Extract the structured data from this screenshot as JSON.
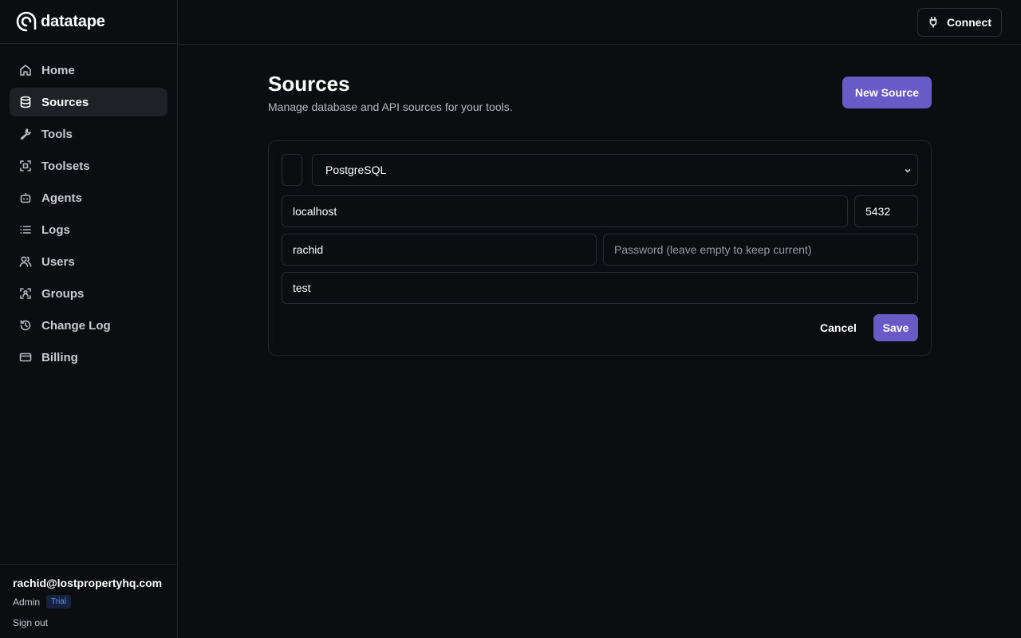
{
  "brand": {
    "name": "datatape",
    "logo_icon": "spiral-logo-icon"
  },
  "sidebar": {
    "items": [
      {
        "label": "Home",
        "icon": "home-icon",
        "active": false
      },
      {
        "label": "Sources",
        "icon": "database-icon",
        "active": true
      },
      {
        "label": "Tools",
        "icon": "wrench-icon",
        "active": false
      },
      {
        "label": "Toolsets",
        "icon": "scan-icon",
        "active": false
      },
      {
        "label": "Agents",
        "icon": "bot-icon",
        "active": false
      },
      {
        "label": "Logs",
        "icon": "list-icon",
        "active": false
      },
      {
        "label": "Users",
        "icon": "users-icon",
        "active": false
      },
      {
        "label": "Groups",
        "icon": "scan-user-icon",
        "active": false
      },
      {
        "label": "Change Log",
        "icon": "history-icon",
        "active": false
      },
      {
        "label": "Billing",
        "icon": "credit-card-icon",
        "active": false
      }
    ]
  },
  "account": {
    "email": "rachid@lostpropertyhq.com",
    "role": "Admin",
    "plan_badge": "Trial",
    "signout_label": "Sign out"
  },
  "topbar": {
    "connect_label": "Connect",
    "connect_icon": "plug-icon"
  },
  "page": {
    "title": "Sources",
    "subtitle": "Manage database and API sources for your tools.",
    "new_source_label": "New Source"
  },
  "form": {
    "source_type": "PostgreSQL",
    "host": "localhost",
    "port": "5432",
    "username": "rachid",
    "password_placeholder": "Password (leave empty to keep current)",
    "database": "test",
    "cancel_label": "Cancel",
    "save_label": "Save"
  },
  "colors": {
    "background": "#0c0d11",
    "accent": "#6a5ac8",
    "active_nav_bg": "#1f2127",
    "badge_text": "#5b8fff"
  }
}
